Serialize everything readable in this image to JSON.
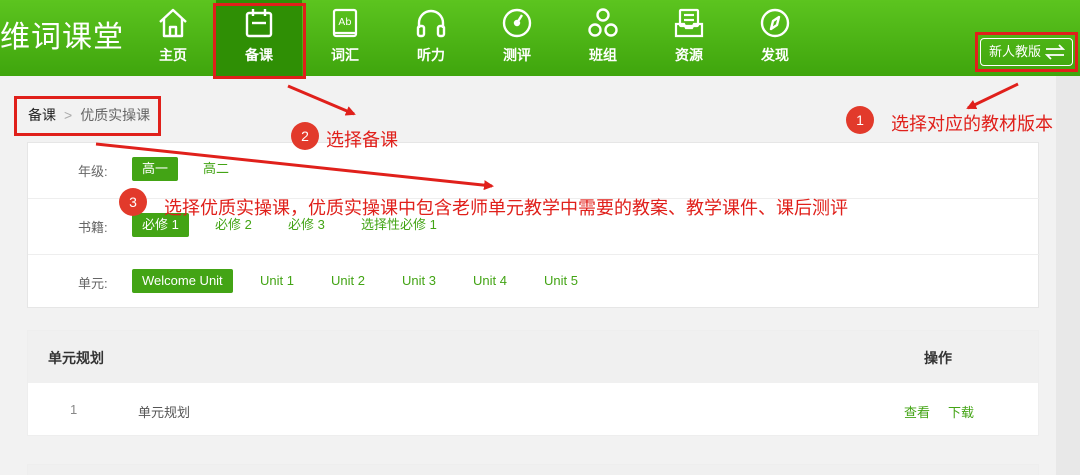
{
  "app": {
    "logo_text": "维词课堂"
  },
  "nav": [
    {
      "label": "主页",
      "icon": "home-icon"
    },
    {
      "label": "备课",
      "icon": "calendar-icon",
      "active": true
    },
    {
      "label": "词汇",
      "icon": "book-icon"
    },
    {
      "label": "听力",
      "icon": "headphones-icon"
    },
    {
      "label": "测评",
      "icon": "gauge-icon"
    },
    {
      "label": "班组",
      "icon": "group-icon"
    },
    {
      "label": "资源",
      "icon": "inbox-icon"
    },
    {
      "label": "发现",
      "icon": "compass-icon"
    }
  ],
  "edition": {
    "label": "新人教版",
    "icon": "swap-arrows-icon"
  },
  "annotations": {
    "step1": {
      "num": "1",
      "text": "选择对应的教材版本"
    },
    "step2": {
      "num": "2",
      "text": "选择备课"
    },
    "step3": {
      "num": "3",
      "text": "选择优质实操课，优质实操课中包含老师单元教学中需要的教案、教学课件、课后测评"
    },
    "color": "#e0201b"
  },
  "breadcrumb": {
    "current": "备课",
    "separator": ">",
    "sub": "优质实操课"
  },
  "filters": {
    "grade": {
      "label": "年级:",
      "options": [
        "高一",
        "高二"
      ],
      "selected": 0
    },
    "book": {
      "label": "书籍:",
      "options": [
        "必修 1",
        "必修 2",
        "必修 3",
        "选择性必修 1"
      ],
      "selected": 0
    },
    "unit": {
      "label": "单元:",
      "options": [
        "Welcome Unit",
        "Unit 1",
        "Unit 2",
        "Unit 3",
        "Unit 4",
        "Unit 5"
      ],
      "selected": 0
    }
  },
  "table": {
    "headers": {
      "title": "单元规划",
      "action": "操作"
    },
    "rows": [
      {
        "index": "1",
        "name": "单元规划",
        "view": "查看",
        "download": "下载"
      }
    ]
  },
  "colors": {
    "brand_green": "#43a415",
    "nav_gradient_top": "#5cc41f",
    "nav_gradient_bottom": "#3fa50d",
    "annotation_red": "#e0201b"
  }
}
